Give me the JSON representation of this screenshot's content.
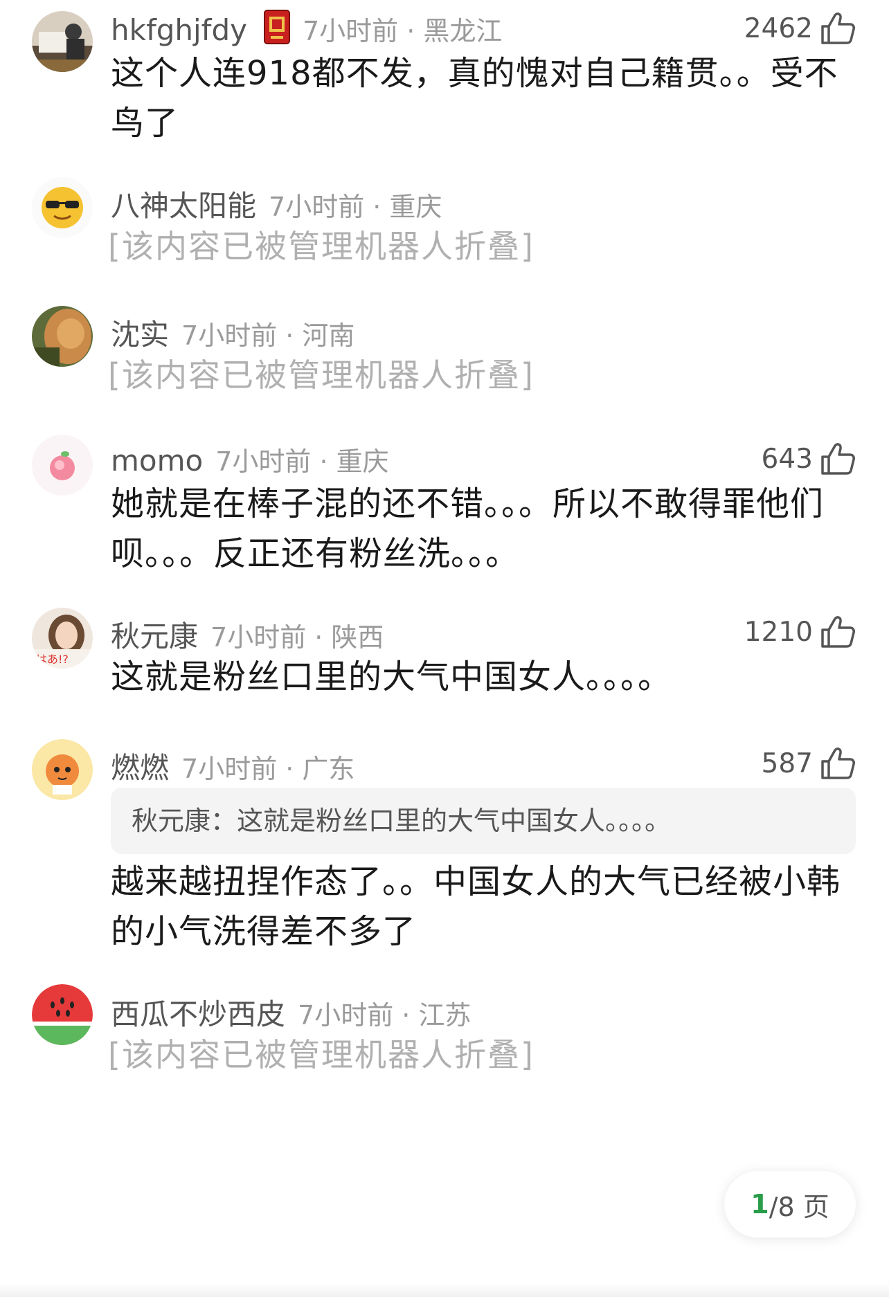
{
  "comments": [
    {
      "username": "hkfghjfdy",
      "time_location": "7小时前 · 黑龙江",
      "likes": "2462",
      "text": "这个人连918都不发，真的愧对自己籍贯。。受不鸟了",
      "avatar": "photo-avatar",
      "badge": "red-card-badge"
    },
    {
      "username": "八神太阳能",
      "time_location": "7小时前 · 重庆",
      "folded_text": "[该内容已被管理机器人折叠]",
      "avatar": "sunglasses-emoji-avatar"
    },
    {
      "username": "沈实",
      "time_location": "7小时前 · 河南",
      "folded_text": "[该内容已被管理机器人折叠]",
      "avatar": "cat-photo-avatar"
    },
    {
      "username": "momo",
      "time_location": "7小时前 · 重庆",
      "likes": "643",
      "text": "她就是在棒子混的还不错。。。所以不敢得罪他们呗。。。反正还有粉丝洗。。。",
      "avatar": "peach-avatar"
    },
    {
      "username": "秋元康",
      "time_location": "7小时前 · 陕西",
      "likes": "1210",
      "text": "这就是粉丝口里的大气中国女人。。。。",
      "avatar": "girl-photo-avatar"
    },
    {
      "username": "燃燃",
      "time_location": "7小时前 · 广东",
      "likes": "587",
      "quote": "秋元康：这就是粉丝口里的大气中国女人。。。。",
      "text": "越来越扭捏作态了。。中国女人的大气已经被小韩的小气洗得差不多了",
      "avatar": "tiger-cartoon-avatar"
    },
    {
      "username": "西瓜不炒西皮",
      "time_location": "7小时前 · 江苏",
      "folded_text": "[该内容已被管理机器人折叠]",
      "avatar": "watermelon-avatar"
    }
  ],
  "pager": {
    "current": "1",
    "total_label": "/8 页"
  },
  "colors": {
    "accent_green": "#2a9d4a",
    "meta_gray": "#9a9a9a",
    "folded_gray": "#b0b0b0"
  }
}
